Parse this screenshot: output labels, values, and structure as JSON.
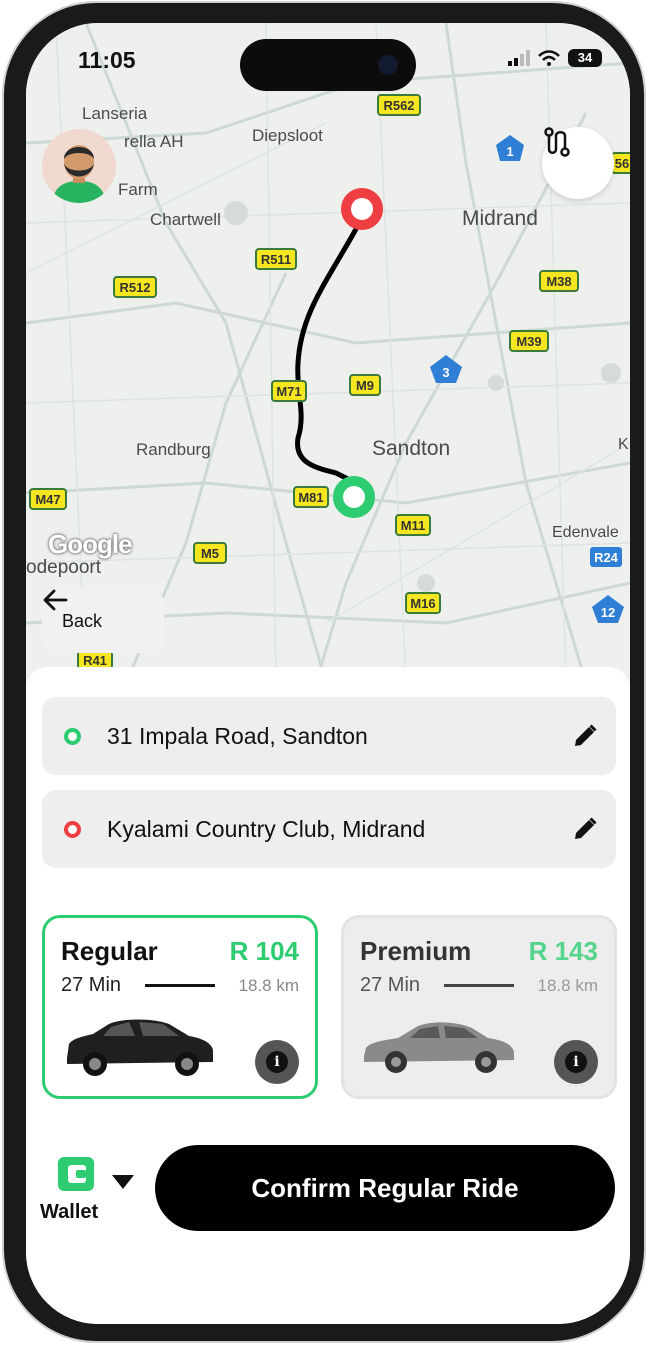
{
  "status_bar": {
    "time": "11:05",
    "battery": "34"
  },
  "map": {
    "places": [
      "Lanseria",
      "rella AH",
      "Diepsloot",
      "Farm",
      "Chartwell",
      "Midrand",
      "Randburg",
      "Sandton",
      "Edenvale",
      "odepoort",
      "K"
    ],
    "roads": [
      "R562",
      "1",
      "56",
      "R511",
      "R512",
      "M38",
      "M39",
      "3",
      "M71",
      "M9",
      "M47",
      "M81",
      "M11",
      "M5",
      "R24",
      "M16",
      "12",
      "R41"
    ],
    "attribution": "Google"
  },
  "back": {
    "label": "Back"
  },
  "addresses": {
    "pickup": "31 Impala Road, Sandton",
    "dropoff": "Kyalami Country Club, Midrand"
  },
  "rides": [
    {
      "name": "Regular",
      "price": "R 104",
      "time": "27 Min",
      "distance": "18.8 km"
    },
    {
      "name": "Premium",
      "price": "R 143",
      "time": "27 Min",
      "distance": "18.8 km"
    }
  ],
  "payment": {
    "label": "Wallet"
  },
  "confirm": {
    "label": "Confirm Regular Ride"
  },
  "colors": {
    "accent": "#2ecc71",
    "destination": "#ef3e42",
    "map_road": "#c9d6d0",
    "road_shield": "#f6e61f"
  },
  "icons": [
    "wifi-icon",
    "signal-icon",
    "route-icon",
    "arrow-left-icon",
    "pencil-icon",
    "info-icon",
    "wallet-icon",
    "caret-down-icon"
  ]
}
